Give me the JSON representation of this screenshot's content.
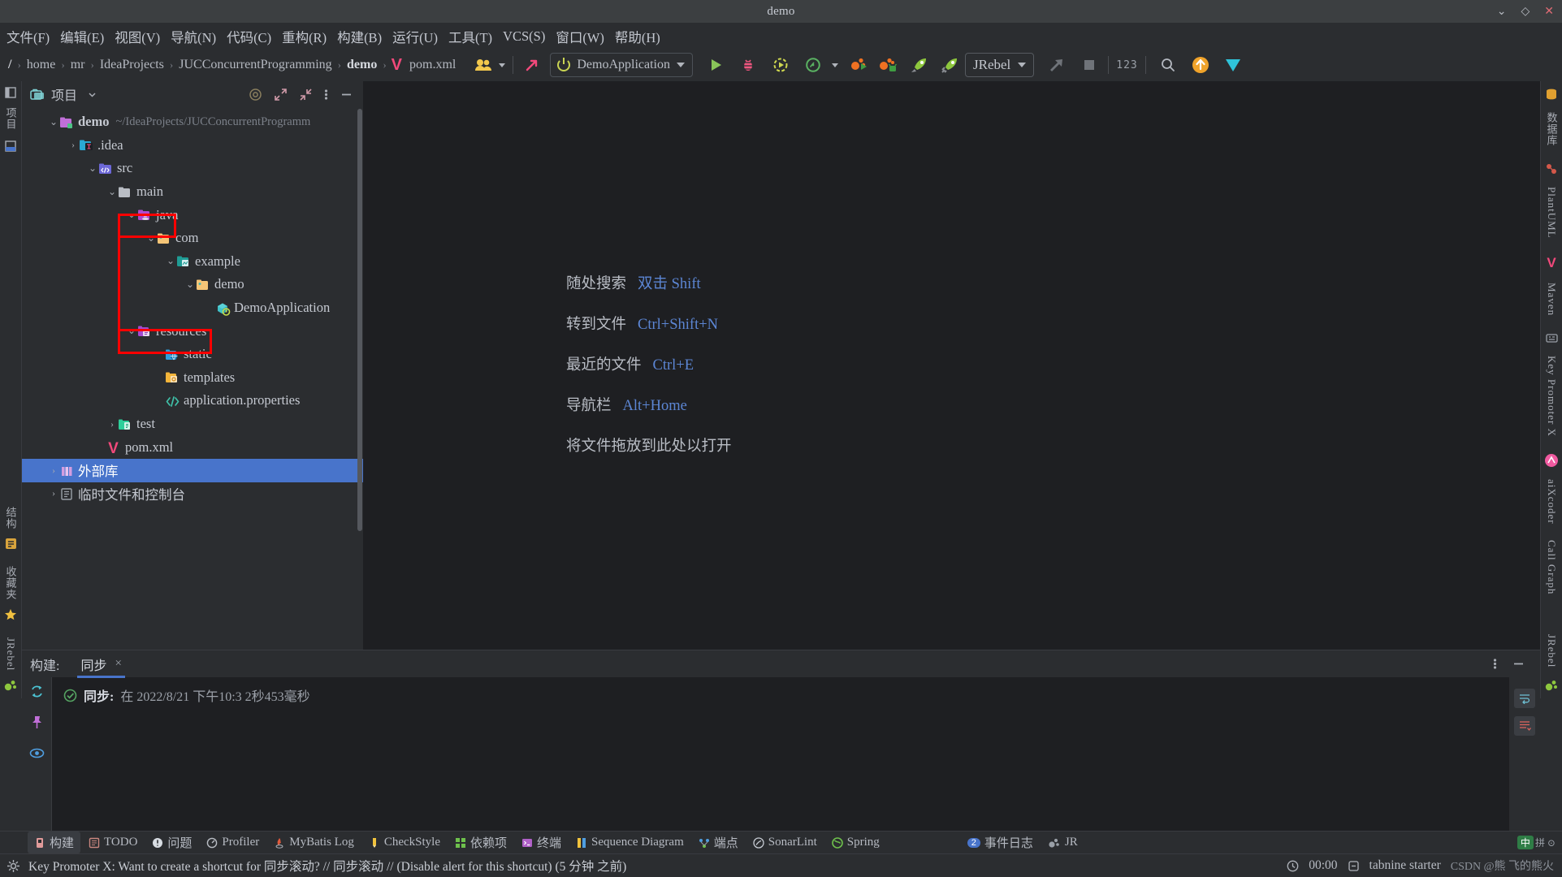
{
  "window": {
    "title": "demo",
    "controls": [
      "minimize-chevron",
      "maximize-diamond",
      "close"
    ]
  },
  "menubar": [
    {
      "label": "文件(F)",
      "mn": "F"
    },
    {
      "label": "编辑(E)",
      "mn": "E"
    },
    {
      "label": "视图(V)",
      "mn": "V"
    },
    {
      "label": "导航(N)",
      "mn": "N"
    },
    {
      "label": "代码(C)",
      "mn": "C"
    },
    {
      "label": "重构(R)",
      "mn": "R"
    },
    {
      "label": "构建(B)",
      "mn": "B"
    },
    {
      "label": "运行(U)",
      "mn": "U"
    },
    {
      "label": "工具(T)",
      "mn": "T"
    },
    {
      "label": "VCS(S)",
      "mn": "S"
    },
    {
      "label": "窗口(W)",
      "mn": "W"
    },
    {
      "label": "帮助(H)",
      "mn": "H"
    }
  ],
  "breadcrumb": [
    "/",
    "home",
    "mr",
    "IdeaProjects",
    "JUCConcurrentProgramming",
    "demo",
    "pom.xml"
  ],
  "breadcrumb_bold_index": 5,
  "toolbar": {
    "run_config": "DemoApplication",
    "jrebel_label": "JRebel",
    "line_numbers_toggle": "123",
    "icons": [
      "people-icon",
      "arrow-up-right-icon",
      "run-icon",
      "debug-icon",
      "run-with-coverage-icon",
      "profiler-icon",
      "dropdown-icon",
      "jrebel-debug-icon",
      "jrebel-run-icon",
      "rocket-run-icon",
      "rocket-debug-icon",
      "build-icon",
      "stop-icon",
      "search-icon",
      "update-icon",
      "plugin-icon"
    ]
  },
  "project_panel": {
    "title": "项目",
    "header_icons": [
      "target-icon",
      "expand-icon",
      "collapse-icon",
      "more-icon",
      "hide-icon"
    ],
    "tree": [
      {
        "depth": 0,
        "arrow": "down",
        "icon": "module-folder",
        "name": "demo",
        "bold": true,
        "sub": "~/IdeaProjects/JUCConcurrentProgramm"
      },
      {
        "depth": 1,
        "arrow": "right",
        "icon": "idea-folder",
        "name": ".idea",
        "bold": false,
        "sub": ""
      },
      {
        "depth": 1,
        "arrow": "down",
        "icon": "src-folder",
        "name": "src",
        "bold": false,
        "sub": ""
      },
      {
        "depth": 2,
        "arrow": "down",
        "icon": "plain-folder",
        "name": "main",
        "bold": false,
        "sub": ""
      },
      {
        "depth": 3,
        "arrow": "down",
        "icon": "java-folder",
        "name": "java",
        "bold": false,
        "sub": ""
      },
      {
        "depth": 4,
        "arrow": "down",
        "icon": "package-folder",
        "name": "com",
        "bold": false,
        "sub": ""
      },
      {
        "depth": 5,
        "arrow": "down",
        "icon": "pkg-teal-folder",
        "name": "example",
        "bold": false,
        "sub": ""
      },
      {
        "depth": 6,
        "arrow": "down",
        "icon": "package-folder",
        "name": "demo",
        "bold": false,
        "sub": ""
      },
      {
        "depth": 7,
        "arrow": "none",
        "icon": "spring-class",
        "name": "DemoApplication",
        "bold": false,
        "sub": ""
      },
      {
        "depth": 3,
        "arrow": "down",
        "icon": "resources-folder",
        "name": "resources",
        "bold": false,
        "sub": ""
      },
      {
        "depth": 4,
        "arrow": "none",
        "icon": "static-folder",
        "name": "static",
        "bold": false,
        "sub": ""
      },
      {
        "depth": 4,
        "arrow": "none",
        "icon": "templates-folder",
        "name": "templates",
        "bold": false,
        "sub": ""
      },
      {
        "depth": 4,
        "arrow": "none",
        "icon": "properties-file",
        "name": "application.properties",
        "bold": false,
        "sub": ""
      },
      {
        "depth": 2,
        "arrow": "right",
        "icon": "test-folder",
        "name": "test",
        "bold": false,
        "sub": ""
      },
      {
        "depth": 2,
        "arrow": "none",
        "icon": "maven-file",
        "name": "pom.xml",
        "bold": false,
        "sub": ""
      },
      {
        "depth": 0,
        "arrow": "right",
        "icon": "library-icon",
        "name": "外部库",
        "bold": false,
        "sub": "",
        "selected": true
      },
      {
        "depth": 0,
        "arrow": "right",
        "icon": "scratches-icon",
        "name": "临时文件和控制台",
        "bold": false,
        "sub": ""
      }
    ],
    "highlighted_rows": [
      "java",
      "resources"
    ]
  },
  "editor_tips": [
    {
      "text": "随处搜索",
      "shortcut": "双击 Shift"
    },
    {
      "text": "转到文件",
      "shortcut": "Ctrl+Shift+N"
    },
    {
      "text": "最近的文件",
      "shortcut": "Ctrl+E"
    },
    {
      "text": "导航栏",
      "shortcut": "Alt+Home"
    },
    {
      "text": "将文件拖放到此处以打开",
      "shortcut": ""
    }
  ],
  "left_strip": [
    "项目",
    "结构",
    "收藏夹",
    "JRebel"
  ],
  "right_strip": [
    "数据库",
    "PlantUML",
    "Maven",
    "Key Promoter X",
    "aiXcoder",
    "Call Graph",
    "JRebel"
  ],
  "build_panel": {
    "label": "构建:",
    "tab": "同步",
    "tab_close": "×",
    "sync_status": "同步:",
    "sync_detail": "在 2022/8/21 下午10:3 2秒453毫秒",
    "gutter_icons": [
      "rerun-icon",
      "pin-icon",
      "eye-icon"
    ],
    "right_icons": [
      "soft-wrap-icon",
      "scroll-end-icon"
    ],
    "header_icons": [
      "more-icon",
      "hide-icon"
    ]
  },
  "tool_tabs": [
    {
      "label": "构建",
      "icon": "build-icon",
      "active": true,
      "badge": ""
    },
    {
      "label": "TODO",
      "icon": "todo-icon",
      "active": false,
      "badge": ""
    },
    {
      "label": "问题",
      "icon": "problems-icon",
      "active": false,
      "badge": ""
    },
    {
      "label": "Profiler",
      "icon": "profiler-icon",
      "active": false,
      "badge": ""
    },
    {
      "label": "MyBatis Log",
      "icon": "mybatis-icon",
      "active": false,
      "badge": ""
    },
    {
      "label": "CheckStyle",
      "icon": "checkstyle-icon",
      "active": false,
      "badge": ""
    },
    {
      "label": "依赖项",
      "icon": "dependencies-icon",
      "active": false,
      "badge": ""
    },
    {
      "label": "终端",
      "icon": "terminal-icon",
      "active": false,
      "badge": ""
    },
    {
      "label": "Sequence Diagram",
      "icon": "sequence-diagram-icon",
      "active": false,
      "badge": ""
    },
    {
      "label": "端点",
      "icon": "endpoints-icon",
      "active": false,
      "badge": ""
    },
    {
      "label": "SonarLint",
      "icon": "sonarlint-icon",
      "active": false,
      "badge": ""
    },
    {
      "label": "Spring",
      "icon": "spring-icon",
      "active": false,
      "badge": ""
    },
    {
      "label": "事件日志",
      "icon": "event-log-icon",
      "active": false,
      "badge": "2"
    },
    {
      "label": "JR",
      "icon": "jrebel-icon",
      "active": false,
      "badge": ""
    }
  ],
  "statusbar": {
    "message": "Key Promoter X: Want to create a shortcut for 同步滚动? // 同步滚动 // (Disable alert for this shortcut) (5 分钟 之前)",
    "timer": "00:00",
    "tabnine": "tabnine starter",
    "watermark": "CSDN @熊 飞的熊火",
    "ime_cn": "中",
    "ime_extra": "拼 ⊙"
  }
}
